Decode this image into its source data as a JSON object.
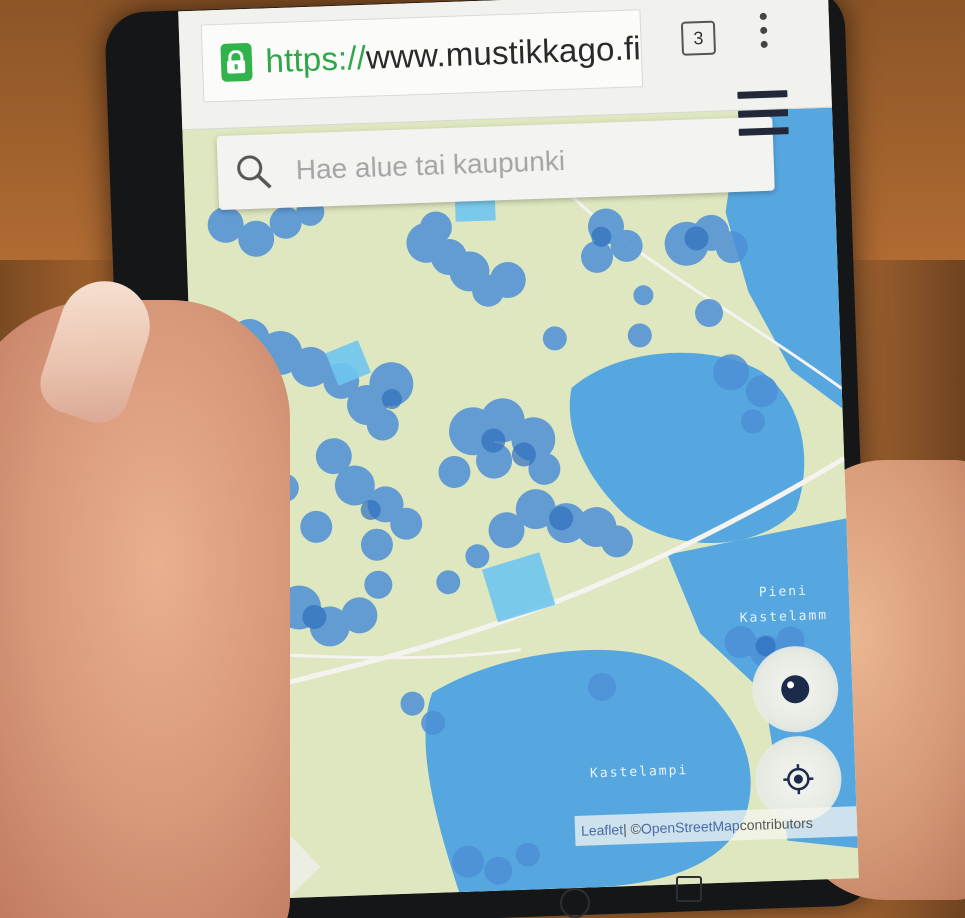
{
  "browser": {
    "url_scheme": "https",
    "url_separator": "://",
    "url_host": "www.mustikkago.fi",
    "tab_count": "3",
    "lock_icon": "lock-icon",
    "accent_color": "#2fb34a"
  },
  "search": {
    "placeholder": "Hae alue tai kaupunki",
    "icon": "search-icon"
  },
  "map": {
    "labels": {
      "lake_small_line1": "Pieni",
      "lake_small_line2": "Kastelamm",
      "lake_main": "Kastelampi"
    },
    "attribution": {
      "leaflet": "Leaflet",
      "separator": " | © ",
      "osm": "OpenStreetMap",
      "contributors": " contributors"
    },
    "water_color": "#56a7e0",
    "land_color": "#dfe7c0",
    "berry_color": "#4d8fd6"
  }
}
